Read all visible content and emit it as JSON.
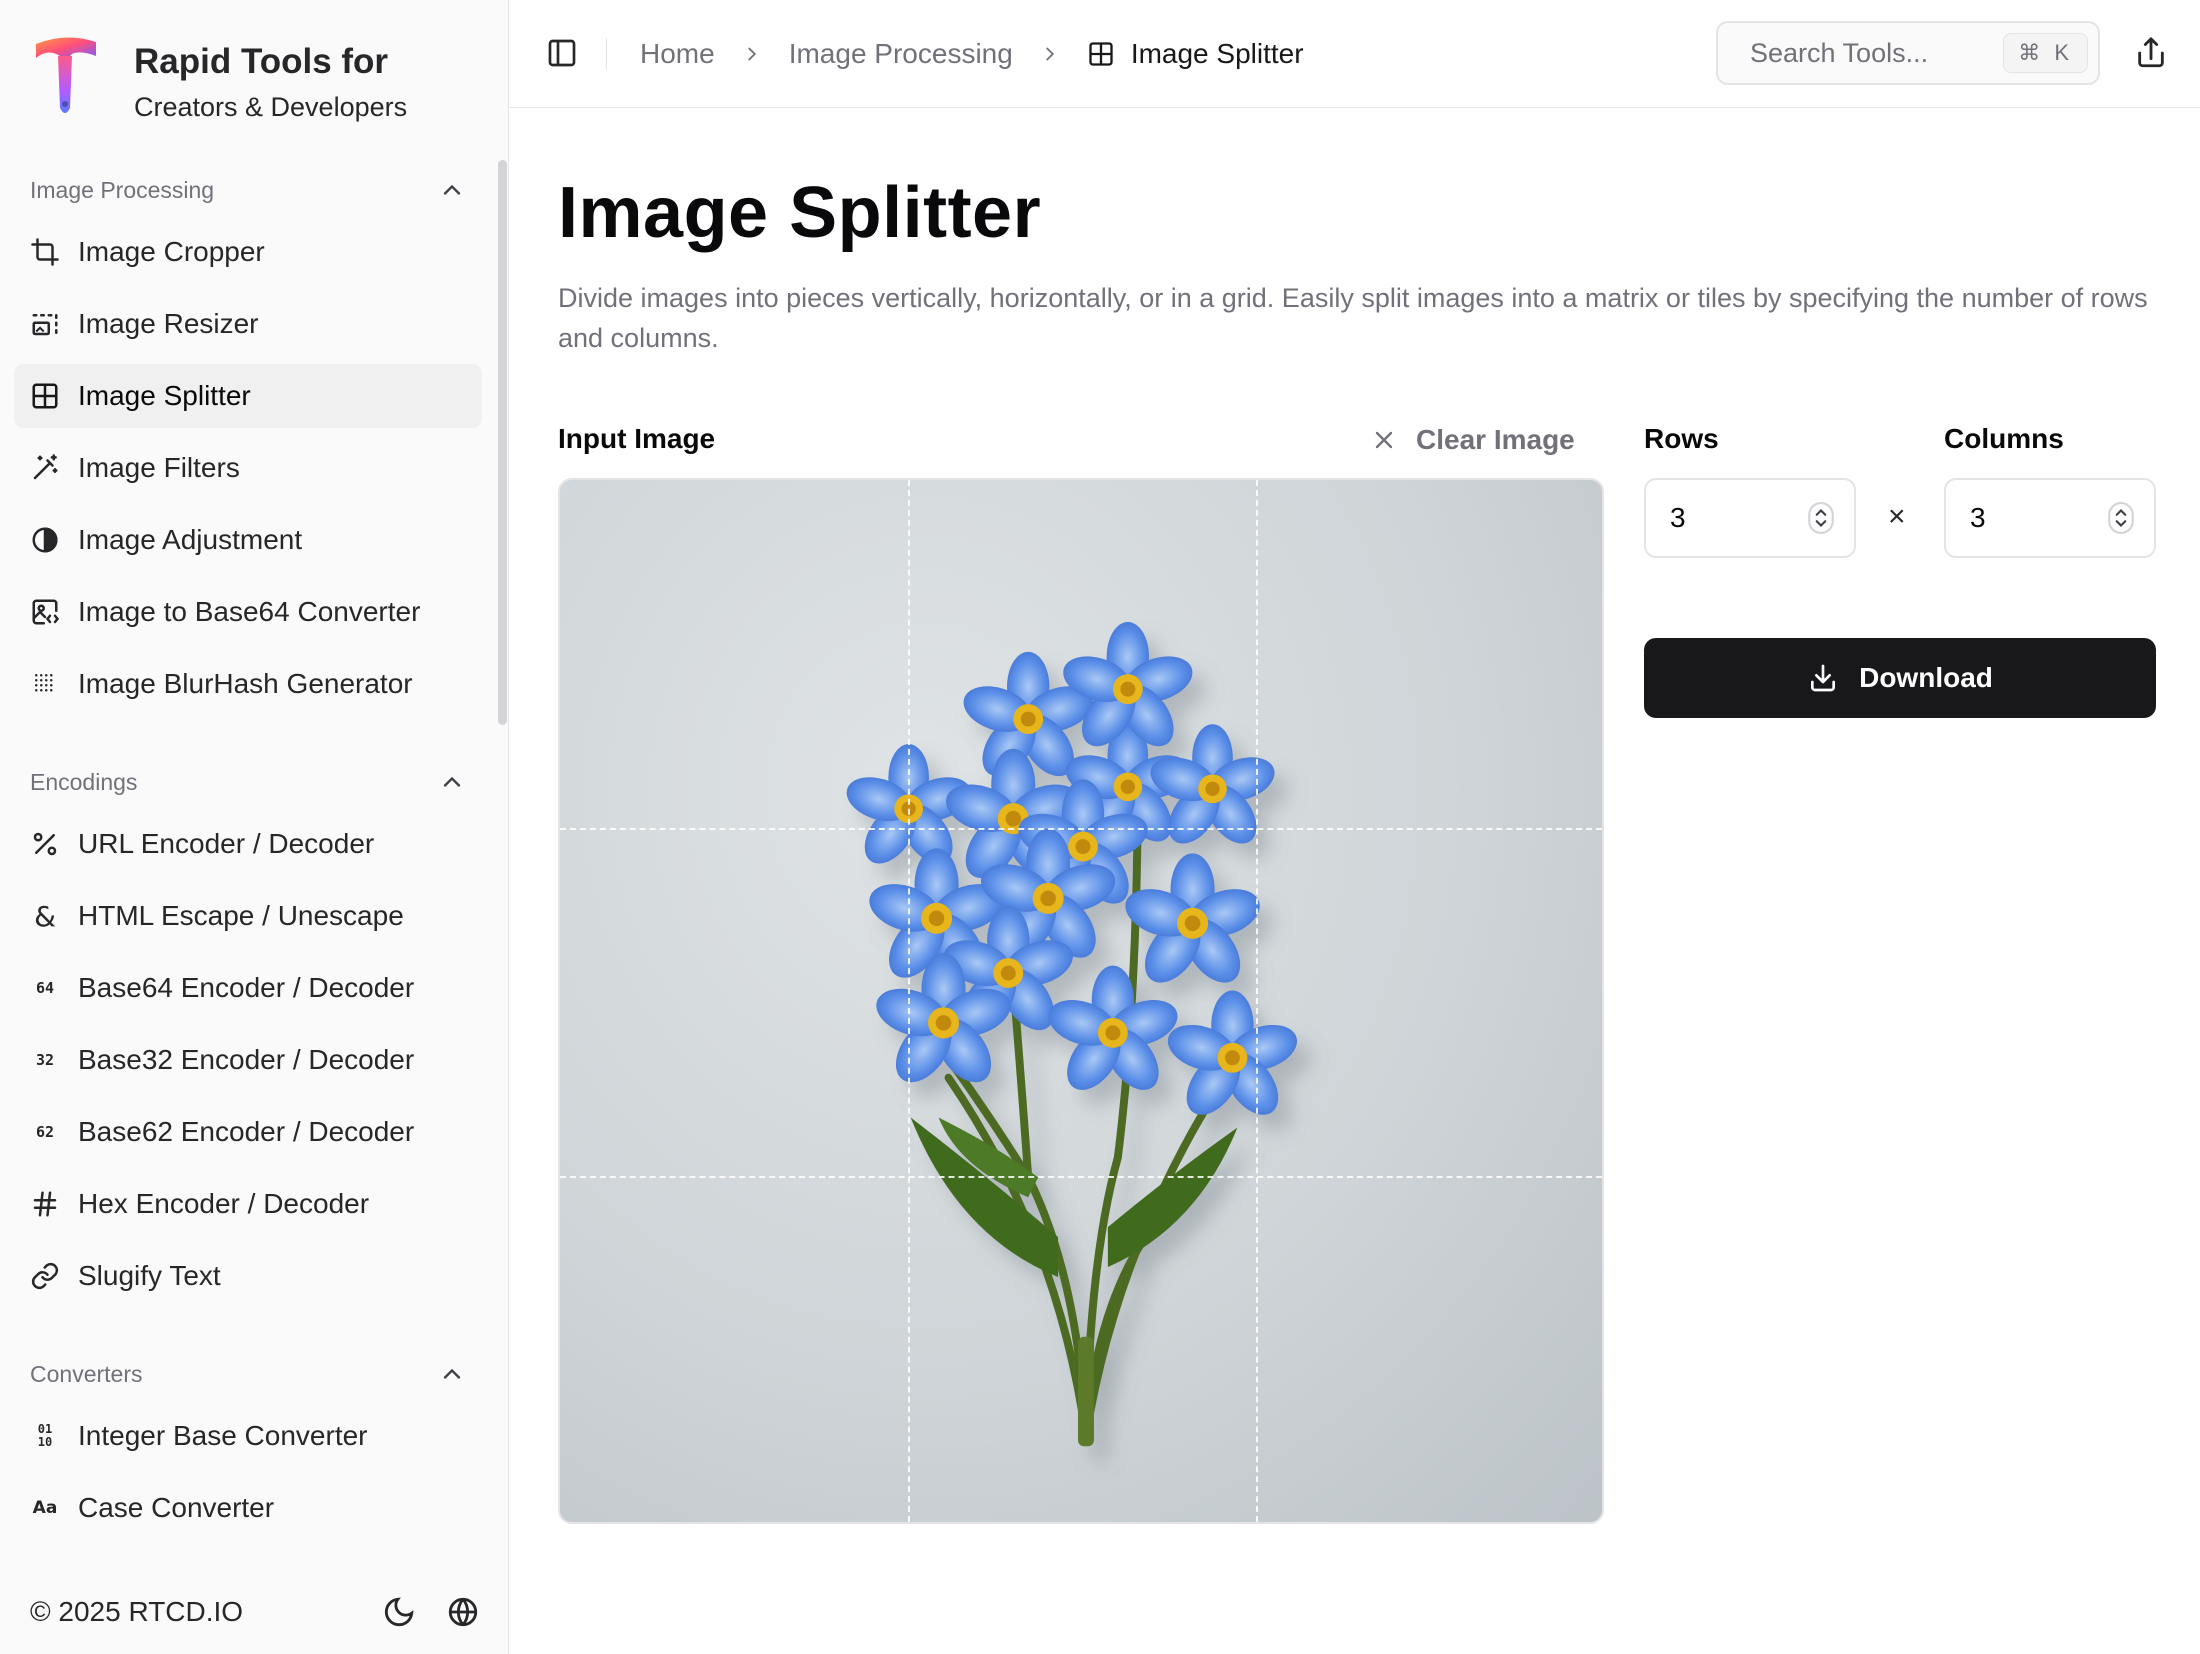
{
  "brand": {
    "title": "Rapid Tools for",
    "subtitle": "Creators & Developers"
  },
  "sidebar": {
    "groups": [
      {
        "label": "Image Processing",
        "items": [
          {
            "label": "Image Cropper",
            "icon": "crop-icon"
          },
          {
            "label": "Image Resizer",
            "icon": "resize-icon"
          },
          {
            "label": "Image Splitter",
            "icon": "grid-icon",
            "active": true
          },
          {
            "label": "Image Filters",
            "icon": "magic-wand-icon"
          },
          {
            "label": "Image Adjustment",
            "icon": "contrast-icon"
          },
          {
            "label": "Image to Base64 Converter",
            "icon": "image-code-icon"
          },
          {
            "label": "Image BlurHash Generator",
            "icon": "dots-grid-icon"
          }
        ]
      },
      {
        "label": "Encodings",
        "items": [
          {
            "label": "URL Encoder / Decoder",
            "icon": "percent-icon"
          },
          {
            "label": "HTML Escape / Unescape",
            "icon": "ampersand-icon"
          },
          {
            "label": "Base64 Encoder / Decoder",
            "icon": "base64-icon",
            "glyph": "64"
          },
          {
            "label": "Base32 Encoder / Decoder",
            "icon": "base32-icon",
            "glyph": "32"
          },
          {
            "label": "Base62 Encoder / Decoder",
            "icon": "base62-icon",
            "glyph": "62"
          },
          {
            "label": "Hex Encoder / Decoder",
            "icon": "hash-icon"
          },
          {
            "label": "Slugify Text",
            "icon": "link-icon"
          }
        ]
      },
      {
        "label": "Converters",
        "items": [
          {
            "label": "Integer Base Converter",
            "icon": "binary-icon",
            "glyph": "01\n10"
          },
          {
            "label": "Case Converter",
            "icon": "case-icon",
            "glyph": "Aa"
          }
        ]
      }
    ],
    "footer": {
      "copyright": "© 2025 RTCD.IO"
    }
  },
  "topbar": {
    "breadcrumbs": [
      "Home",
      "Image Processing",
      "Image Splitter"
    ],
    "search_placeholder": "Search Tools...",
    "shortcut": "⌘ K"
  },
  "main": {
    "title": "Image Splitter",
    "description": "Divide images into pieces vertically, horizontally, or in a grid. Easily split images into a matrix or tiles by specifying the number of rows and columns.",
    "input_label": "Input Image",
    "clear_label": "Clear Image",
    "rows_label": "Rows",
    "rows_value": "3",
    "columns_label": "Columns",
    "columns_value": "3",
    "times_symbol": "×",
    "download_label": "Download"
  },
  "colors": {
    "accent": "#18181b",
    "muted": "#71717a",
    "border": "#e4e4e7",
    "sidebar_bg": "#fafafa"
  }
}
